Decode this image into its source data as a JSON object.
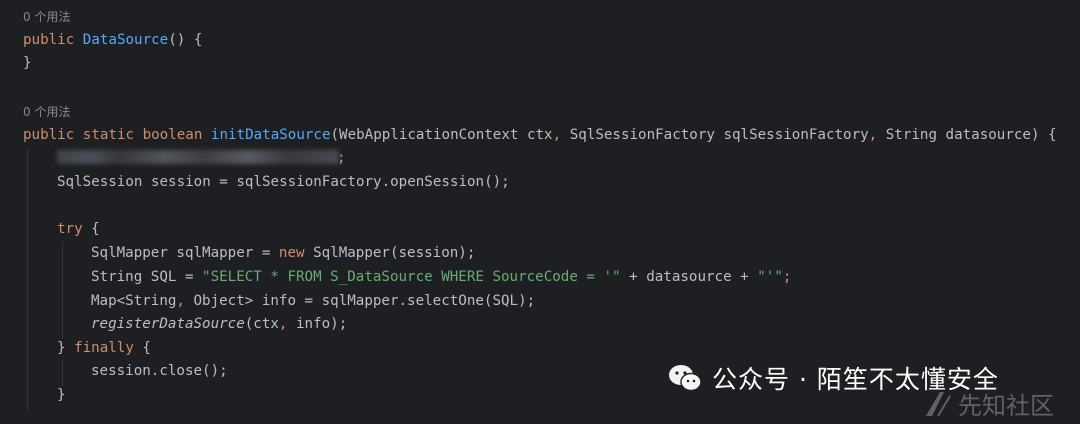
{
  "colors": {
    "background": "#1e1f22",
    "keyword": "#cf8e6d",
    "function": "#56a8f5",
    "string": "#6aab73",
    "text": "#bcbec4",
    "hint": "#868a91"
  },
  "code": {
    "usage_hint_1": "0 个用法",
    "line_constructor_kw": "public ",
    "line_constructor_name": "DataSource",
    "line_constructor_rest": "() {",
    "line_close_1": "}",
    "usage_hint_2": "0 个用法",
    "sig_kw": "public static boolean ",
    "sig_name": "initDataSource",
    "sig_p1": "(WebApplicationContext ctx",
    "sig_c1": ",",
    "sig_p2": " SqlSessionFactory sqlSessionFactory",
    "sig_c2": ",",
    "sig_p3": " String datasource) {",
    "blurred_tail": ";",
    "session_line": "SqlSession session = sqlSessionFactory.openSession();",
    "try_kw": "try",
    "try_rest": " {",
    "mapper_a": "SqlMapper sqlMapper = ",
    "mapper_new": "new",
    "mapper_b": " SqlMapper(session);",
    "sql_a": "String SQL = ",
    "sql_str1": "\"SELECT * FROM S_DataSource WHERE SourceCode = '\"",
    "sql_b": " + datasource + ",
    "sql_str2": "\"'\"",
    "sql_end": ";",
    "map_a": "Map<String",
    "map_c": ",",
    "map_b": " Object> info = sqlMapper.selectOne(SQL);",
    "reg_name": "registerDataSource",
    "reg_a": "(ctx",
    "reg_c": ",",
    "reg_b": " info);",
    "finally_a": "} ",
    "finally_kw": "finally",
    "finally_b": " {",
    "close_call": "session.close();",
    "close_brace": "}"
  },
  "watermark": {
    "text": "公众号 · 陌笙不太懂安全",
    "site": "先知社区",
    "icon": "wechat-icon"
  }
}
